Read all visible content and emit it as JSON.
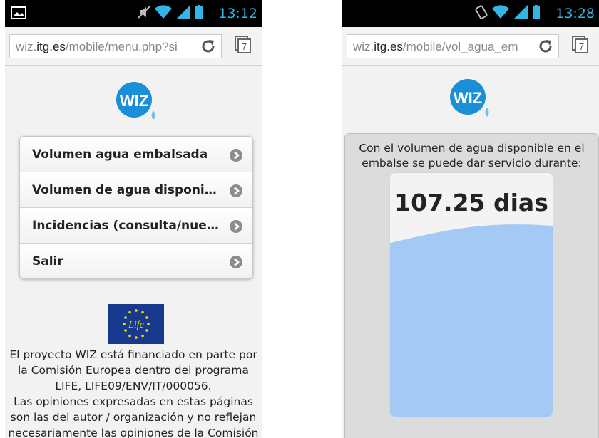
{
  "left_screen": {
    "status": {
      "time": "13:12"
    },
    "browser": {
      "url_prefix": "wiz.",
      "url_domain": "itg.es",
      "url_path": "/mobile/menu.php?si",
      "tabs_count": "7"
    },
    "logo_text": "WIZ",
    "menu": {
      "items": [
        {
          "label": "Volumen agua embalsada"
        },
        {
          "label": "Volumen de agua disponible en el embalse"
        },
        {
          "label": "Incidencias (consulta/nueva)"
        },
        {
          "label": "Salir"
        }
      ]
    },
    "eu_logo_text": "Life",
    "footer": {
      "line1": "El proyecto WIZ está financiado en parte por",
      "line2": "la Comisión Europea dentro del programa",
      "line3": "LIFE, LIFE09/ENV/IT/000056.",
      "line4": "Las opiniones expresadas en estas páginas",
      "line5": "son las del autor / organización y no reflejan",
      "line6": "necesariamente las opiniones de la Comisión"
    }
  },
  "right_screen": {
    "status": {
      "time": "13:28"
    },
    "browser": {
      "url_prefix": "wiz.",
      "url_domain": "itg.es",
      "url_path": "/mobile/vol_agua_em",
      "tabs_count": "7"
    },
    "logo_text": "WIZ",
    "info": {
      "line1": "Con el volumen de agua disponible en el",
      "line2": "embalse se puede dar servicio durante:",
      "value": "107.25 dias",
      "fill_fraction": 0.79
    }
  },
  "colors": {
    "accent": "#33b5e5",
    "logo_blue": "#1a8fd8",
    "water": "#a4c9f4"
  }
}
